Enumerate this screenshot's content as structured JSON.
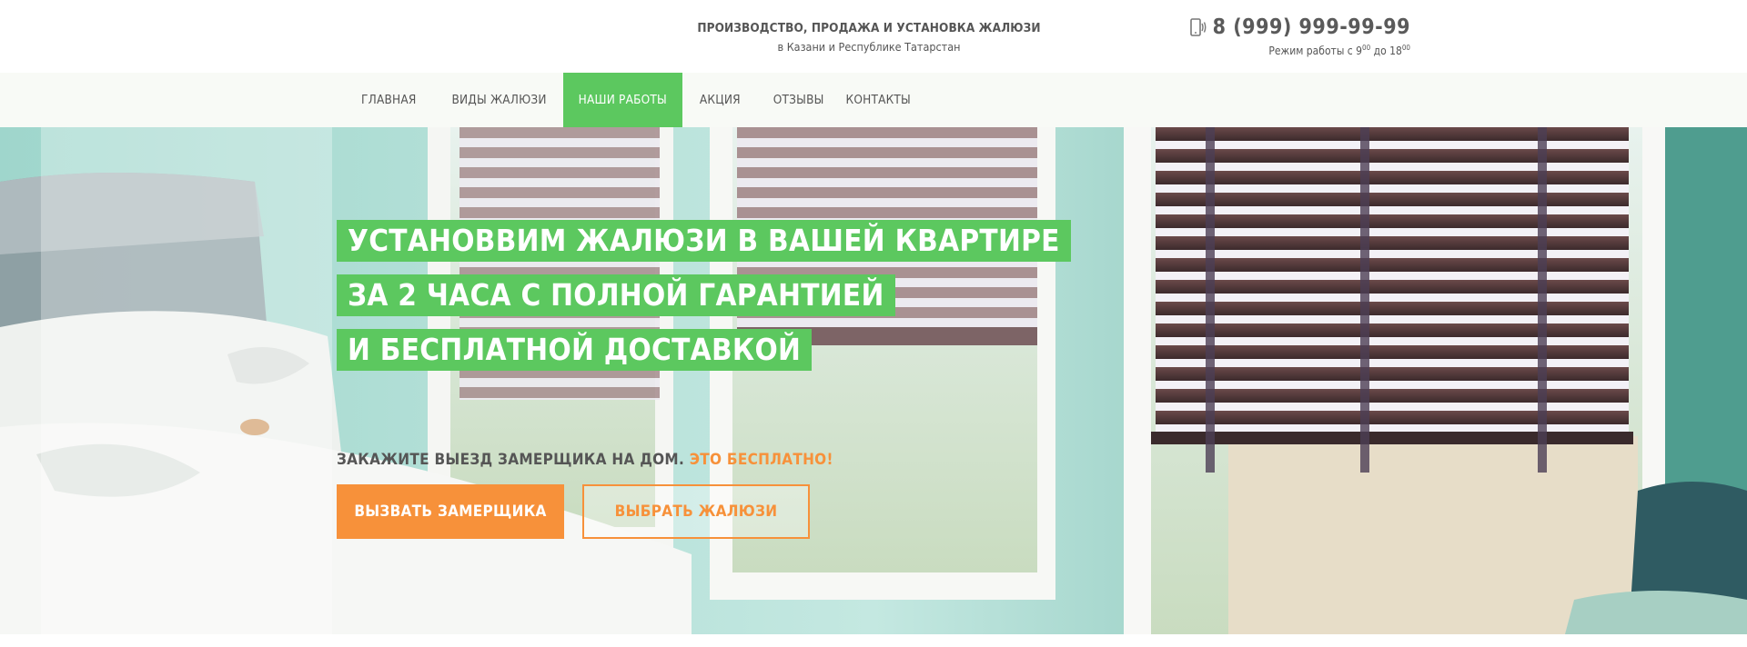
{
  "header": {
    "tagline_main": "ПРОИЗВОДСТВО, ПРОДАЖА И УСТАНОВКА ЖАЛЮЗИ",
    "tagline_sub": "в Казани и Республике Татарстан",
    "phone": "8 (999) 999-99-99",
    "hours_prefix": "Режим работы с 9",
    "hours_from_min": "00",
    "hours_mid": " до 18",
    "hours_to_min": "00",
    "phone_icon": "phone-icon"
  },
  "nav": {
    "items": [
      {
        "label": "ГЛАВНАЯ"
      },
      {
        "label": "ВИДЫ ЖАЛЮЗИ"
      },
      {
        "label": "НАШИ РАБОТЫ",
        "active": true
      },
      {
        "label": "АКЦИЯ"
      },
      {
        "label": "ОТЗЫВЫ"
      },
      {
        "label": "КОНТАКТЫ"
      }
    ]
  },
  "hero": {
    "headline": [
      "УСТАНОВВИМ ЖАЛЮЗИ В ВАШЕЙ КВАРТИРЕ",
      "ЗА 2 ЧАСА С ПОЛНОЙ ГАРАНТИЕЙ",
      "И БЕСПЛАТНОЙ ДОСТАВКОЙ"
    ],
    "cta_caption": "ЗАКАЖИТЕ ВЫЕЗД ЗАМЕРЩИКА НА ДОМ.",
    "cta_accent": "ЭТО БЕСПЛАТНО!",
    "primary_button": "ВЫЗВАТЬ ЗАМЕРЩИКА",
    "secondary_button": "ВЫБРАТЬ ЖАЛЮЗИ"
  },
  "colors": {
    "accent_green": "#5cc85f",
    "accent_orange": "#f7913a",
    "text_gray": "#555555",
    "nav_bg": "#f8faf6"
  }
}
